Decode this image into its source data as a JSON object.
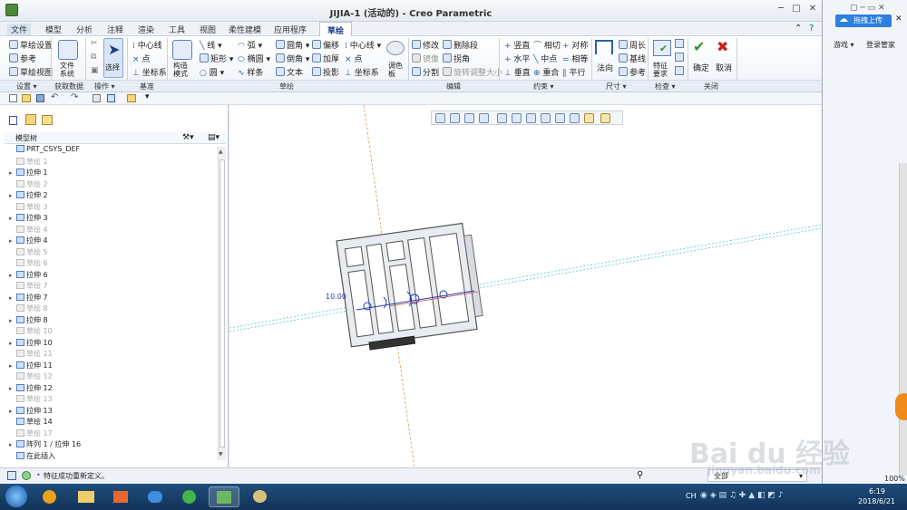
{
  "window": {
    "title": "JIJIA-1 (活动的) - Creo Parametric"
  },
  "menu": {
    "items": [
      "文件",
      "模型",
      "分析",
      "注释",
      "渲染",
      "工具",
      "视图",
      "柔性建模",
      "应用程序"
    ],
    "active_tab": "草绘"
  },
  "ribbon": {
    "settings": {
      "sketch_setup": "草绘设置",
      "reference": "参考",
      "sketch_view": "草绘视图",
      "group": "设置"
    },
    "get_data": {
      "file_system": "文件系统",
      "group": "获取数据"
    },
    "operations": {
      "select": "选择",
      "group": "操作"
    },
    "datum": {
      "centerline": "中心线",
      "point": "点",
      "csys": "坐标系",
      "group": "基准"
    },
    "sketching": {
      "construction_mode": "构造模式",
      "line": "线",
      "arc": "弧",
      "rectangle": "矩形",
      "ellipse": "椭圆",
      "circle": "圆",
      "spline": "样条",
      "fillet": "圆角",
      "chamfer": "倒角",
      "text": "文本",
      "offset": "偏移",
      "thicken": "加厚",
      "project": "投影",
      "centerline": "中心线",
      "point": "点",
      "csys": "坐标系",
      "palette": "调色板",
      "group": "草绘"
    },
    "editing": {
      "modify": "修改",
      "delete_segment": "删除段",
      "mirror": "镜像",
      "corner": "拐角",
      "divide": "分割",
      "rotate_resize": "旋转调整大小",
      "group": "编辑"
    },
    "constrain": {
      "vertical": "竖直",
      "tangent": "相切",
      "symmetric": "对称",
      "horizontal": "水平",
      "midpoint": "中点",
      "equal": "相等",
      "perpendicular": "垂直",
      "coincident": "重合",
      "parallel": "平行",
      "group": "约束"
    },
    "dimension": {
      "normal": "法向",
      "perimeter": "周长",
      "baseline": "基线",
      "reference": "参考",
      "group": "尺寸"
    },
    "inspect": {
      "feature_requirements": "特征要求",
      "group": "检查"
    },
    "close": {
      "ok": "确定",
      "cancel": "取消",
      "group": "关闭"
    }
  },
  "model_tree": {
    "header": "模型树",
    "items": [
      {
        "label": "PRT_CSYS_DEF",
        "dim": false,
        "expand": false
      },
      {
        "label": "草绘 1",
        "dim": true,
        "expand": false
      },
      {
        "label": "拉伸 1",
        "dim": false,
        "expand": true
      },
      {
        "label": "草绘 2",
        "dim": true,
        "expand": false
      },
      {
        "label": "拉伸 2",
        "dim": false,
        "expand": true
      },
      {
        "label": "草绘 3",
        "dim": true,
        "expand": false
      },
      {
        "label": "拉伸 3",
        "dim": false,
        "expand": true
      },
      {
        "label": "草绘 4",
        "dim": true,
        "expand": false
      },
      {
        "label": "拉伸 4",
        "dim": false,
        "expand": true
      },
      {
        "label": "草绘 5",
        "dim": true,
        "expand": false
      },
      {
        "label": "草绘 6",
        "dim": true,
        "expand": false
      },
      {
        "label": "拉伸 6",
        "dim": false,
        "expand": true
      },
      {
        "label": "草绘 7",
        "dim": true,
        "expand": false
      },
      {
        "label": "拉伸 7",
        "dim": false,
        "expand": true
      },
      {
        "label": "草绘 8",
        "dim": true,
        "expand": false
      },
      {
        "label": "拉伸 8",
        "dim": false,
        "expand": true
      },
      {
        "label": "草绘 10",
        "dim": true,
        "expand": false
      },
      {
        "label": "拉伸 10",
        "dim": false,
        "expand": true
      },
      {
        "label": "草绘 11",
        "dim": true,
        "expand": false
      },
      {
        "label": "拉伸 11",
        "dim": false,
        "expand": true
      },
      {
        "label": "草绘 12",
        "dim": true,
        "expand": false
      },
      {
        "label": "拉伸 12",
        "dim": false,
        "expand": true
      },
      {
        "label": "草绘 13",
        "dim": true,
        "expand": false
      },
      {
        "label": "拉伸 13",
        "dim": false,
        "expand": true
      },
      {
        "label": "草绘 14",
        "dim": false,
        "expand": false
      },
      {
        "label": "草绘 17",
        "dim": true,
        "expand": false
      },
      {
        "label": "阵列 1 / 拉伸 16",
        "dim": false,
        "expand": true
      },
      {
        "label": "在此插入",
        "dim": false,
        "expand": false
      }
    ]
  },
  "viewport": {
    "dimension_label": "10.00"
  },
  "status": {
    "message": "特征成功重新定义。",
    "filter": "全部"
  },
  "browser": {
    "upload": "拖拽上传",
    "games": "游戏",
    "login": "登录管家",
    "zoom": "100%"
  },
  "taskbar": {
    "time": "6:19",
    "date": "2018/6/21",
    "lang": "CH"
  },
  "watermark": {
    "brand": "Bai du 经验",
    "url": "jingyan.baidu.com"
  },
  "colors": {
    "ribbon_bg": "#eef3f9",
    "accent": "#1a3d8a",
    "taskbar": "#12345a"
  }
}
